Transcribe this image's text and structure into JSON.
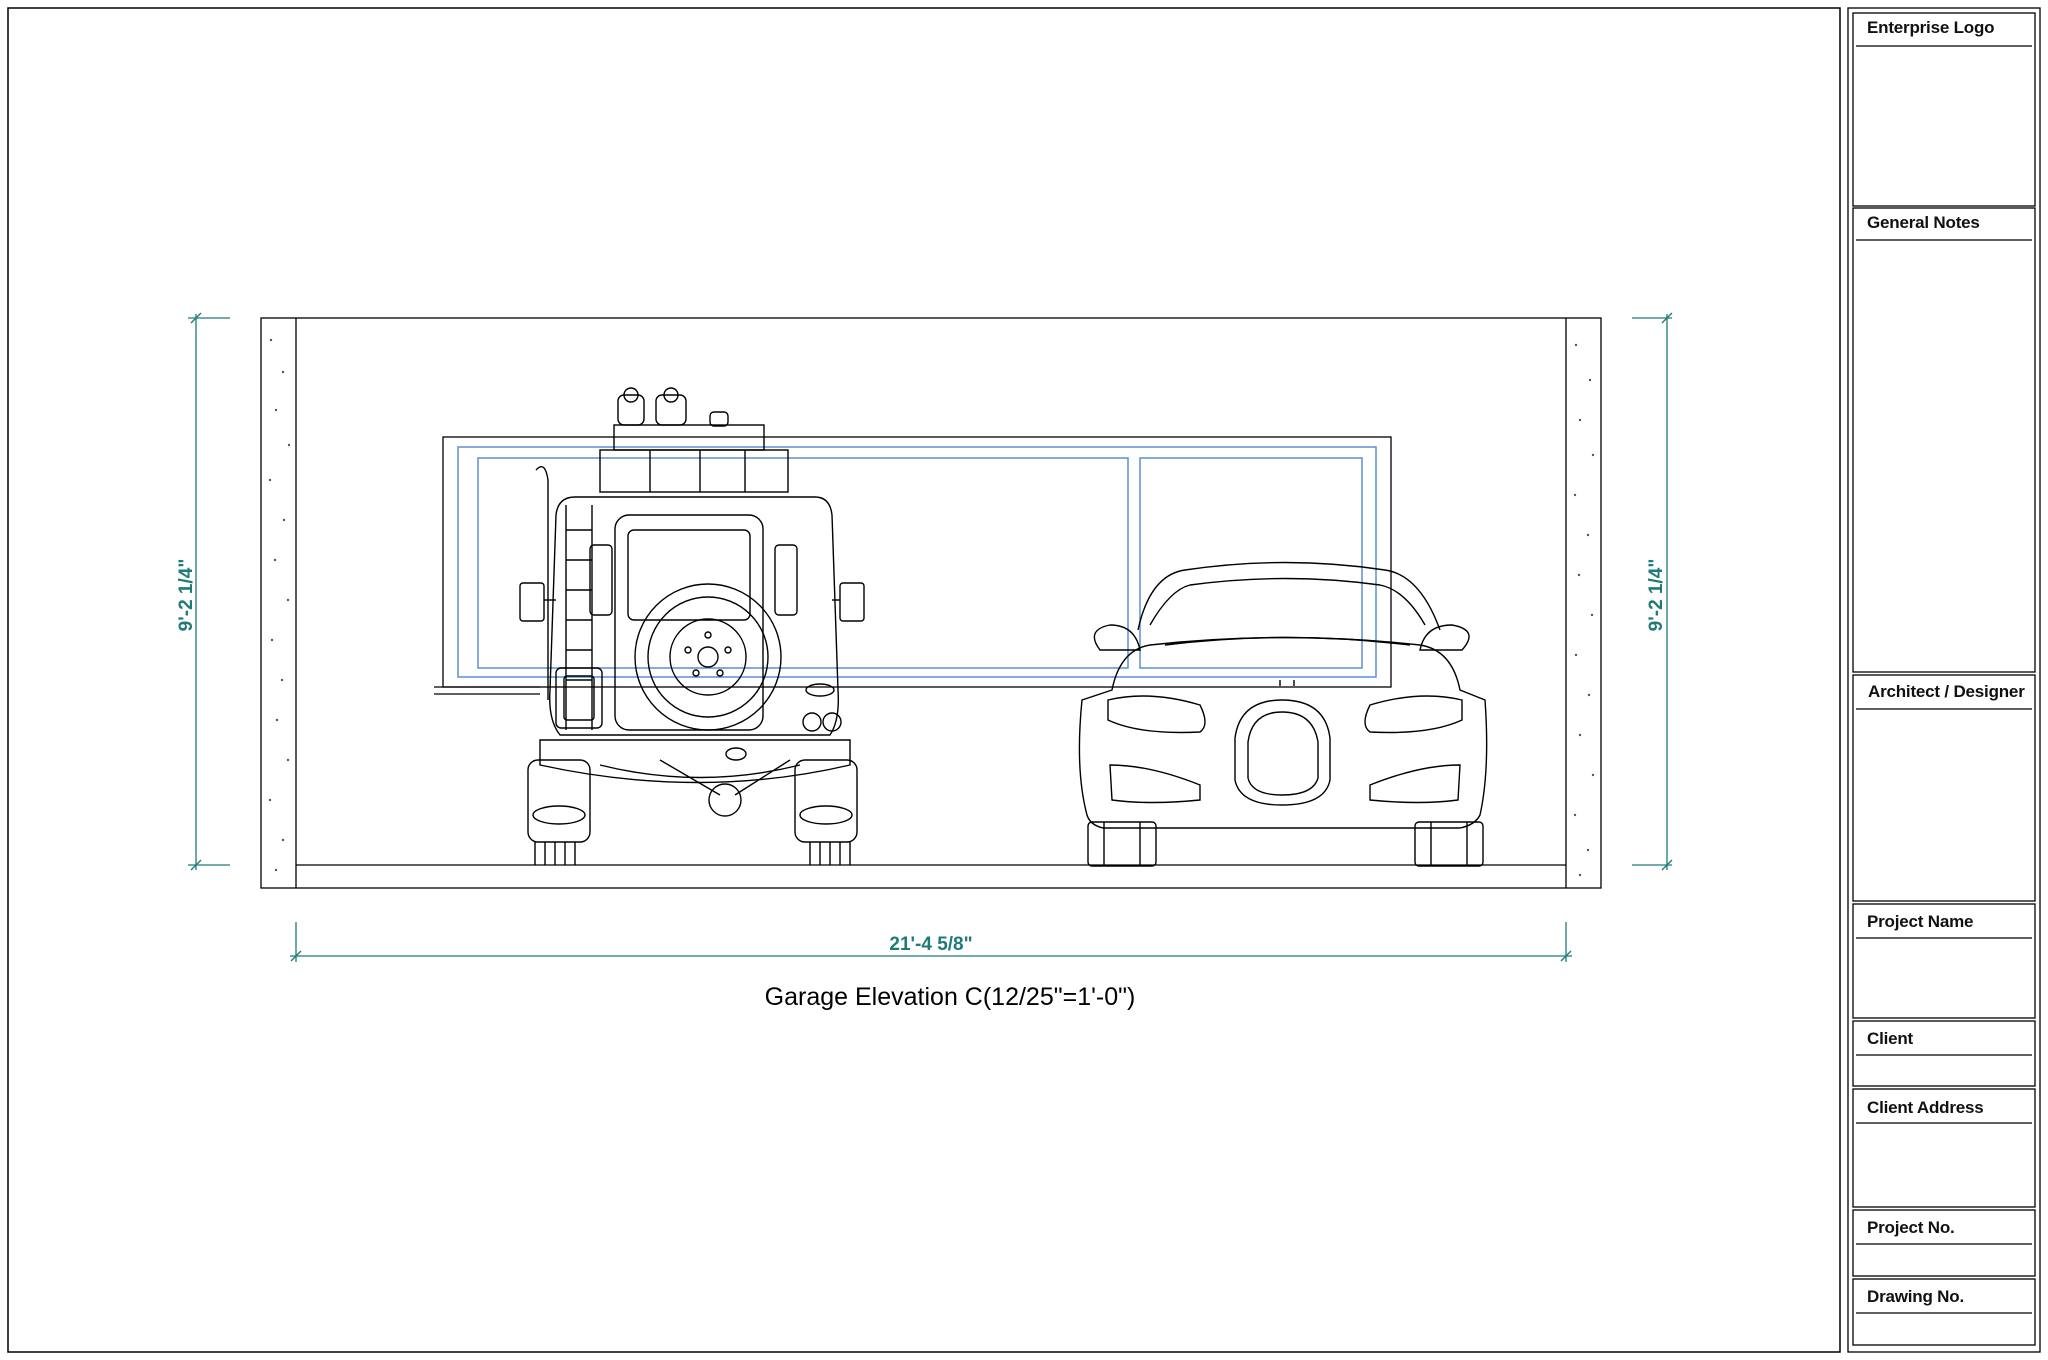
{
  "drawing": {
    "caption": "Garage Elevation C(12/25\"=1'-0\")",
    "dimensions": {
      "left_height": "9'-2 1/4\"",
      "right_height": "9'-2 1/4\"",
      "width": "21'-4 5/8\""
    },
    "colors": {
      "line": "#000000",
      "dimension": "#1f7a7a",
      "window": "#5b8fd4"
    }
  },
  "title_block": {
    "enterprise_logo": "Enterprise Logo",
    "general_notes": "General Notes",
    "architect": "Architect / Designer",
    "project_name": "Project Name",
    "client": "Client",
    "client_address": "Client Address",
    "project_no": "Project No.",
    "drawing_no": "Drawing No."
  }
}
